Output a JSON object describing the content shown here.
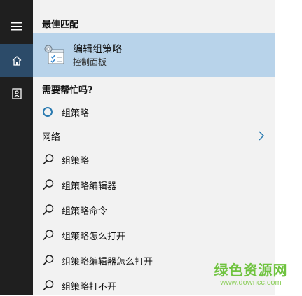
{
  "sections": {
    "best_match": "最佳匹配",
    "need_help": "需要帮忙吗?",
    "web": "网络"
  },
  "best_match": {
    "title": "编辑组策略",
    "subtitle": "控制面板",
    "icon": "group-policy-editor-icon"
  },
  "help_item": {
    "label": "组策略",
    "icon": "circle-icon"
  },
  "web_results": [
    "组策略",
    "组策略编辑器",
    "组策略命令",
    "组策略怎么打开",
    "组策略编辑器怎么打开",
    "组策略打不开"
  ],
  "watermark": {
    "title": "绿色资源网",
    "url": "www.downcc.com"
  },
  "colors": {
    "rail_bg": "#1f1f1f",
    "rail_active": "#2c4b69",
    "panel_bg": "#f2f2f2",
    "selected_bg": "#b8d3ea",
    "accent": "#2a7ab0",
    "watermark": "#6fc33f"
  }
}
